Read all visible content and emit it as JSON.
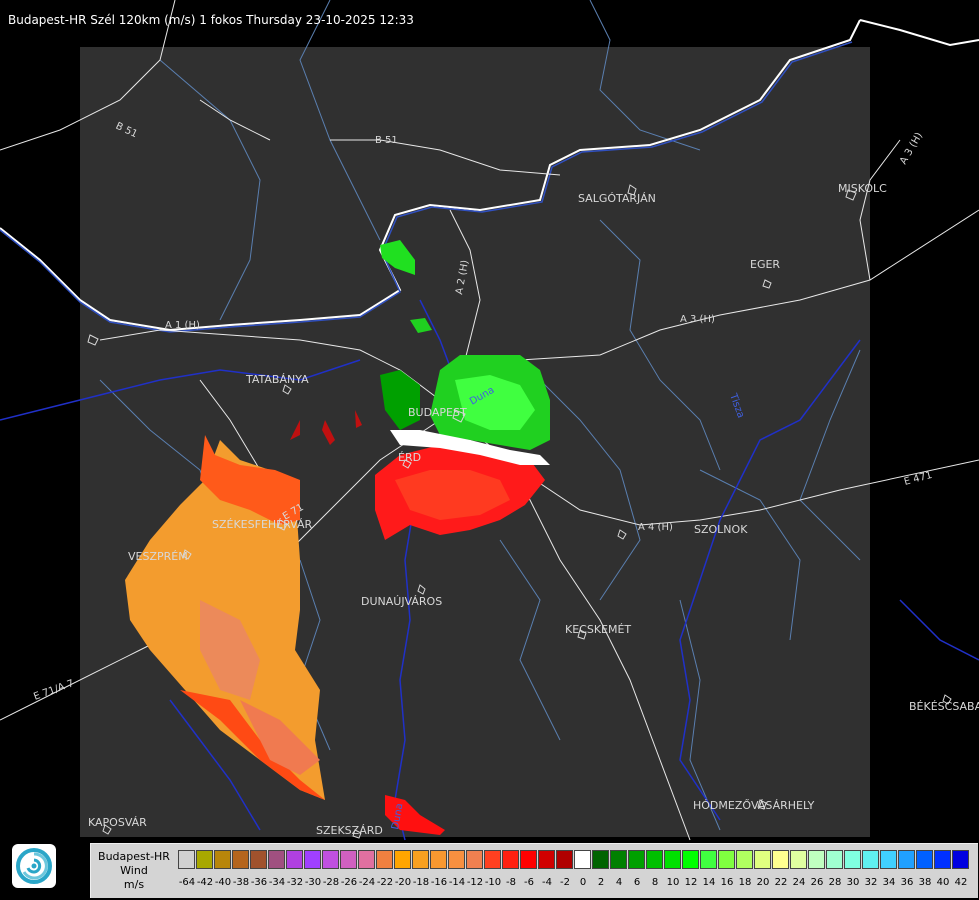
{
  "header": {
    "title": "Budapest-HR Szél 120km (m/s) 1 fokos Thursday 23-10-2025 12:33"
  },
  "cities": [
    {
      "name": "SALGÓTARJÁN"
    },
    {
      "name": "MISKOLC"
    },
    {
      "name": "EGER"
    },
    {
      "name": "TATABÁNYA"
    },
    {
      "name": "BUDAPEST"
    },
    {
      "name": "ÉRD"
    },
    {
      "name": "SZÉKESFEHÉRVÁR"
    },
    {
      "name": "VESZPRÉM"
    },
    {
      "name": "DUNAÚJVÁROS"
    },
    {
      "name": "KECSKEMÉT"
    },
    {
      "name": "SZOLNOK"
    },
    {
      "name": "BÉKÉSCSABA"
    },
    {
      "name": "HÓDMEZŐVÁSÁRHELY"
    },
    {
      "name": "KAPOSVÁR"
    },
    {
      "name": "SZEKSZÁRD"
    }
  ],
  "roads": [
    {
      "name": "B 51"
    },
    {
      "name": "B 51"
    },
    {
      "name": "A 1 (H)"
    },
    {
      "name": "A 2 (H)"
    },
    {
      "name": "A 3 (H)"
    },
    {
      "name": "A 3 (H)"
    },
    {
      "name": "A 4 (H)"
    },
    {
      "name": "E 71"
    },
    {
      "name": "E 71/A 7"
    },
    {
      "name": "E 471"
    }
  ],
  "rivers": [
    {
      "name": "Duna"
    },
    {
      "name": "Tisza"
    },
    {
      "name": "Duna"
    }
  ],
  "legend": {
    "title_lines": [
      "Budapest-HR",
      "Wind",
      "m/s"
    ],
    "ticks": [
      "-64",
      "-42",
      "-40",
      "-38",
      "-36",
      "-34",
      "-32",
      "-30",
      "-28",
      "-26",
      "-24",
      "-22",
      "-20",
      "-18",
      "-16",
      "-14",
      "-12",
      "-10",
      "-8",
      "-6",
      "-4",
      "-2",
      "0",
      "2",
      "4",
      "6",
      "8",
      "10",
      "12",
      "14",
      "16",
      "18",
      "20",
      "22",
      "24",
      "26",
      "28",
      "30",
      "32",
      "34",
      "36",
      "38",
      "40",
      "42"
    ],
    "colors": [
      "#d0d0d0",
      "#a8a800",
      "#b8860b",
      "#b5651d",
      "#a0522d",
      "#a05080",
      "#b040e0",
      "#a040ff",
      "#c050e0",
      "#d060c0",
      "#e070a0",
      "#f08040",
      "#ffa500",
      "#f8a020",
      "#f89830",
      "#f89040",
      "#f08050",
      "#ff4020",
      "#ff2010",
      "#ff0000",
      "#d00000",
      "#b00000",
      "#ffffff",
      "#006400",
      "#008000",
      "#00a000",
      "#00c000",
      "#00e000",
      "#00ff00",
      "#40ff40",
      "#80ff40",
      "#b0ff60",
      "#e0ff80",
      "#ffff90",
      "#e0ffa0",
      "#c0ffc0",
      "#a0ffd0",
      "#80ffe0",
      "#60f0f0",
      "#40d0ff",
      "#20a0ff",
      "#0060ff",
      "#0030ff",
      "#0000e0"
    ]
  },
  "icons": {
    "logo": "swirl-logo-icon"
  }
}
